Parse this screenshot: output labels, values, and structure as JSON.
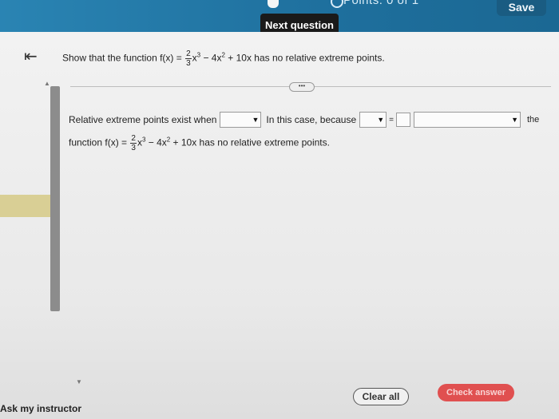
{
  "header": {
    "points_text": "Points: 0 of 1",
    "save_label": "Save",
    "next_question_label": "Next question",
    "colors": {
      "bar": "#1e6f9d",
      "save": "#1a5c82"
    }
  },
  "nav": {
    "back_icon": "first-page-icon"
  },
  "question": {
    "prefix": "Show that the function f(x) =",
    "frac_num": "2",
    "frac_den": "3",
    "term1": "x",
    "exp1": "3",
    "term2": " − 4x",
    "exp2": "2",
    "suffix": " + 10x has no relative extreme points."
  },
  "more_label": "•••",
  "answer": {
    "part1": "Relative extreme points exist when",
    "part2": "In this case, because",
    "equals": "=",
    "part3": "the",
    "line2_prefix": "function f(x) =",
    "line2_suffix": " + 10x has no relative extreme points."
  },
  "footer": {
    "clear_all": "Clear all",
    "check_answer": "Check answer",
    "ask_instructor": "Ask my instructor",
    "check_color": "#e05050"
  }
}
